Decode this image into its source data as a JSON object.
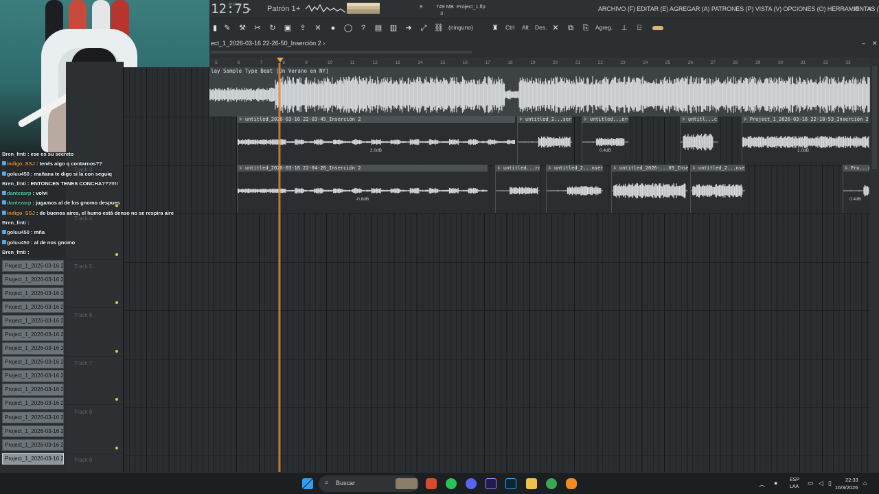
{
  "topbar": {
    "clock": "12:75",
    "clock_sub": "M:S:CS",
    "pattern": "Patrón 1",
    "pattern_add": "+",
    "cpu_num": "9",
    "memory": "749 MB",
    "polyphony": "3",
    "project_file": "Project_1.flp",
    "menu": "ARCHIVO (F) EDITAR (E) AGREGAR (A) PATRONES (P) VISTA (V) OPCIONES (O) HERRAMIENTAS (T) AYUDA",
    "win_min": "–",
    "win_restore": "⧉",
    "win_close": "✕"
  },
  "toolbar": {
    "ninguno": "(ninguno)",
    "ctrl": "Ctrl",
    "alt": "Alt",
    "des": "Des.",
    "agreg": "Agreg."
  },
  "playlist": {
    "title": "ect_1_2026-03-16 22-26-50_Inserción 2",
    "title_arrow": "›",
    "master_label": "lay Sample Type Beat [Un Verano en NY]",
    "ruler_ticks": [
      "5",
      "6",
      "7",
      "8",
      "9",
      "10",
      "11",
      "12",
      "13",
      "14",
      "15",
      "16",
      "17",
      "18",
      "19",
      "20",
      "21",
      "22",
      "23",
      "24",
      "25",
      "26",
      "27",
      "28",
      "29",
      "30",
      "31",
      "32",
      "33"
    ],
    "track1_clips": [
      {
        "name": "untitled_2026-03-16 22-03-45_Inserción 2",
        "db": "2.0dB"
      },
      {
        "name": "untitled_2...serción 2",
        "db": ""
      },
      {
        "name": "untitled...erción 2",
        "db": "0.4dB"
      },
      {
        "name": "untitl...ción 2",
        "db": ""
      },
      {
        "name": "Project_1_2026-03-16 22-18-53_Inserción 2",
        "db": "1.0dB"
      }
    ],
    "track2_clips": [
      {
        "name": "untitled_2026-03-16 22-04-26_Inserción 2",
        "db": "-0.8dB"
      },
      {
        "name": "untitled...rción 2",
        "db": ""
      },
      {
        "name": "untitled_2...nserción 2",
        "db": ""
      },
      {
        "name": "untitled_2026-...09_Inserción 2",
        "db": ""
      },
      {
        "name": "untitled_2...nserción 2",
        "db": ""
      },
      {
        "name": "Pro...n 2",
        "db": "0.4dB"
      }
    ],
    "track_headers": [
      "Track 3",
      "Track 4",
      "Track 5",
      "Track 6",
      "Track 7",
      "Track 8",
      "Track 9"
    ],
    "picker_items": [
      "Project_1_2026-03-16 2...",
      "Project_1_2026-03-16 2...",
      "Project_1_2026-03-16 2...",
      "Project_1_2026-03-16 2...",
      "Project_1_2026-03-16 2...",
      "Project_1_2026-03-16 2...",
      "Project_1_2026-03-16 2...",
      "Project_1_2026-03-16 2...",
      "Project_1_2026-03-16 2...",
      "Project_1_2026-03-16 2...",
      "Project_1_2026-03-16 2...",
      "Project_1_2026-03-16 2...",
      "Project_1_2026-03-16 2...",
      "Project_1_2026-03-16 2...",
      "Project_1_2026-03-16 2..."
    ]
  },
  "chat": [
    {
      "user": "Bren_fmti",
      "text": ": ese es su secreto",
      "color": "white"
    },
    {
      "user": "indigo_SSJ",
      "text": ": tenés algo q contarnos??",
      "color": "orange"
    },
    {
      "user": "goluu450",
      "text": ": mañana te digo si la con seguiq",
      "color": "white"
    },
    {
      "user": "Bren_fmti",
      "text": ": ENTONCES TENES CONCHA???!!!!",
      "color": "white"
    },
    {
      "user": "dantezarp",
      "text": ": volvi",
      "color": "green"
    },
    {
      "user": "dantezarp",
      "text": ": jugamos al de los gnomo despues",
      "color": "green"
    },
    {
      "user": "indigo_SSJ",
      "text": ": de buenos aires, el humo está denso no se respira aire",
      "color": "orange"
    },
    {
      "user": "Bren_fmti",
      "text": ":",
      "color": "white"
    },
    {
      "user": "goluu450",
      "text": ": mña",
      "color": "white"
    },
    {
      "user": "goluu450",
      "text": ": al de nos gnomo",
      "color": "white"
    },
    {
      "user": "Bren_fmti",
      "text": ":",
      "color": "white"
    }
  ],
  "taskbar": {
    "search": "Buscar",
    "lang1": "ESP",
    "lang2": "LAA",
    "time": "22:33",
    "date": "16/3/2026"
  },
  "colors": {
    "accent_orange": "#e8893a",
    "clip_header": "#4b5155",
    "wave": "#d9dcde"
  },
  "icons": [
    "pencil-icon",
    "brush-icon",
    "cut-icon",
    "mute-icon",
    "loop-icon",
    "save-icon",
    "render-icon",
    "mic-icon",
    "chat-icon",
    "help-icon",
    "piano-icon",
    "link-icon",
    "magnet-icon"
  ]
}
